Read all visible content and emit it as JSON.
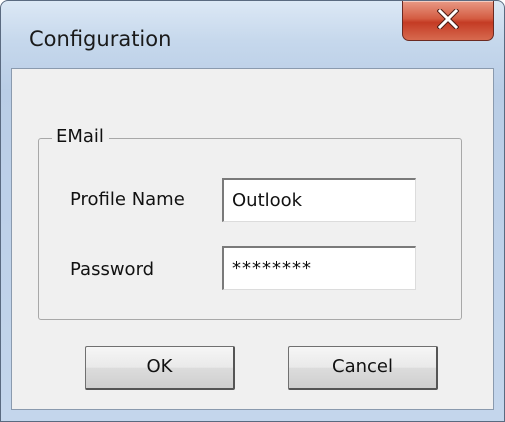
{
  "window": {
    "title": "Configuration",
    "close_glyph": "X"
  },
  "group": {
    "legend": "EMail"
  },
  "fields": {
    "profile_name": {
      "label": "Profile Name",
      "value": "Outlook"
    },
    "password": {
      "label": "Password",
      "value": "********"
    }
  },
  "buttons": {
    "ok": "OK",
    "cancel": "Cancel"
  },
  "icons": {
    "close": "close-icon"
  },
  "colors": {
    "close_button": "#c94a32",
    "dialog_background": "#f0f0f0",
    "title_bar": "#c6d8ec"
  }
}
